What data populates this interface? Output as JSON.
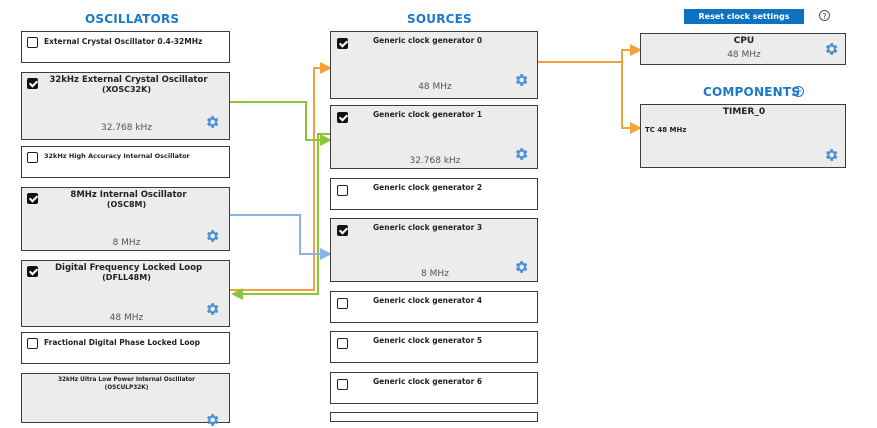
{
  "headers": {
    "oscillators": "OSCILLATORS",
    "sources": "SOURCES",
    "components": "COMPONENTS"
  },
  "toolbar": {
    "reset_label": "Reset clock settings",
    "help_glyph": "?"
  },
  "oscillators": [
    {
      "name": "External Crystal Oscillator 0.4-32MHz",
      "checked": false
    },
    {
      "name": "32kHz External Crystal Oscillator",
      "sub": "(XOSC32K)",
      "freq": "32.768 kHz",
      "checked": true
    },
    {
      "name": "32kHz High Accuracy Internal Oscillator",
      "checked": false
    },
    {
      "name": "8MHz Internal Oscillator",
      "sub": "(OSC8M)",
      "freq": "8 MHz",
      "checked": true
    },
    {
      "name": "Digital Frequency Locked Loop",
      "sub": "(DFLL48M)",
      "freq": "48 MHz",
      "checked": true
    },
    {
      "name": "Fractional Digital Phase Locked Loop",
      "checked": false
    },
    {
      "name": "32kHz Ultra Low Power Internal Oscillator",
      "sub": "(OSCULP32K)",
      "checked": false
    }
  ],
  "sources": [
    {
      "name": "Generic clock generator 0",
      "freq": "48 MHz",
      "checked": true
    },
    {
      "name": "Generic clock generator 1",
      "freq": "32.768 kHz",
      "checked": true
    },
    {
      "name": "Generic clock generator 2",
      "checked": false
    },
    {
      "name": "Generic clock generator 3",
      "freq": "8 MHz",
      "checked": true
    },
    {
      "name": "Generic clock generator 4",
      "checked": false
    },
    {
      "name": "Generic clock generator 5",
      "checked": false
    },
    {
      "name": "Generic clock generator 6",
      "checked": false
    }
  ],
  "cpu": {
    "name": "CPU",
    "freq": "48 MHz"
  },
  "components": [
    {
      "name": "TIMER_0",
      "input_label": "TC 48 MHz"
    }
  ],
  "colors": {
    "accent": "#1a79c8",
    "button": "#0b73c2",
    "gear": "#4a90d9",
    "wire_orange": "#f5a23a",
    "wire_green": "#8cc43c",
    "wire_blue": "#8bb2e6"
  },
  "icons": {
    "settings": "gear-icon",
    "checkbox": "checkbox-icon",
    "add": "plus-circle-icon",
    "help": "help-icon"
  }
}
